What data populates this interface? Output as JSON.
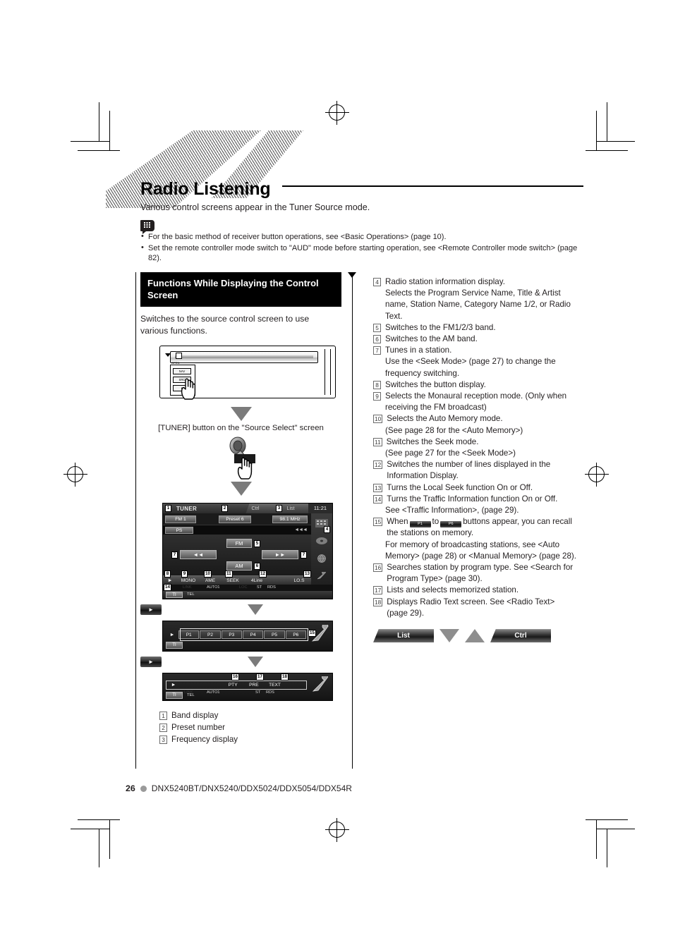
{
  "page": {
    "title": "Radio Listening",
    "intro": "Various control screens appear in the Tuner Source mode.",
    "note_icon": "note-book-icon",
    "notes": [
      "For the basic method of receiver button operations, see <Basic Operations> (page 10).",
      "Set the remote controller mode switch to \"AUD\" mode before starting operation, see <Remote Controller mode switch> (page 82)."
    ],
    "footer": {
      "page_number": "26",
      "models": "DNX5240BT/DNX5240/DDX5024/DDX5054/DDX54R"
    }
  },
  "left_column": {
    "section_heading": "Functions While Displaying the Control Screen",
    "lead": "Switches to the source control screen to use various functions.",
    "device": {
      "button_labels": [
        "NAV",
        "SRC",
        "■"
      ],
      "top_label": "OPEN",
      "hand_icon": "pointing-hand-icon"
    },
    "caption": "[TUNER] button on the \"Source Select\" screen",
    "speaker_icon": "speaker-icon",
    "speaker_hand_icon": "pointing-hand-icon",
    "control_screen": {
      "source_name": "TUNER",
      "ctrl_tab": "Ctrl",
      "list_tab": "List",
      "clock": "11:21",
      "band": "FM   1",
      "preset": "Preset  6",
      "frequency": "98.1 MHz",
      "ps_name": "PS",
      "seek_marker": "◄◄◄",
      "fm_button": "FM",
      "am_button": "AM",
      "prev_button": "◄◄",
      "next_button": "►►",
      "play_button": "►",
      "bottom_buttons": [
        "MONO",
        "AME",
        "SEEK",
        "4Line",
        "",
        "LO.S"
      ],
      "status_row": [
        "AUTO1",
        "ST",
        "RDS"
      ],
      "ti_button": "TI",
      "tel_label": "TEL",
      "callouts": [
        "1",
        "2",
        "3",
        "4",
        "5",
        "6",
        "7",
        "7",
        "8",
        "9",
        "10",
        "11",
        "12",
        "13",
        "14"
      ]
    },
    "preset_panel": {
      "play_button": "►",
      "presets": [
        "P1",
        "P2",
        "P3",
        "P4",
        "P5",
        "P6"
      ],
      "ti_button": "TI",
      "callout": "15"
    },
    "text_panel": {
      "play_button": "►",
      "buttons": [
        "PTY",
        "PRE",
        "TEXT"
      ],
      "status_row": [
        "AUTO1",
        "ST",
        "RDS"
      ],
      "ti_button": "TI",
      "tel_label": "TEL",
      "callouts": [
        "16",
        "17",
        "18"
      ]
    },
    "transition_play_label": "►",
    "legend": [
      {
        "num": "1",
        "text": "Band display"
      },
      {
        "num": "2",
        "text": "Preset number"
      },
      {
        "num": "3",
        "text": "Frequency display"
      }
    ]
  },
  "right_column": {
    "items": [
      {
        "num": "4",
        "text": "Radio station information display.",
        "sub": [
          "Selects the Program Service Name, Title & Artist name, Station Name, Category Name 1/2, or Radio Text."
        ]
      },
      {
        "num": "5",
        "text": "Switches to the FM1/2/3 band.",
        "sub": []
      },
      {
        "num": "6",
        "text": "Switches to the AM band.",
        "sub": []
      },
      {
        "num": "7",
        "text": "Tunes in a station.",
        "sub": [
          "Use the <Seek Mode> (page 27) to change the frequency switching."
        ]
      },
      {
        "num": "8",
        "text": "Switches the button display.",
        "sub": []
      },
      {
        "num": "9",
        "text": "Selects the Monaural reception mode. (Only when receiving the FM broadcast)",
        "sub": []
      },
      {
        "num": "10",
        "text": "Selects the Auto Memory mode.",
        "sub": [
          "(See page 28 for the <Auto Memory>)"
        ]
      },
      {
        "num": "11",
        "text": "Switches the Seek mode.",
        "sub": [
          "(See page 27 for the <Seek Mode>)"
        ]
      },
      {
        "num": "12",
        "text": "Switches the number of lines displayed in the Information Display.",
        "sub": []
      },
      {
        "num": "13",
        "text": "Turns the Local Seek function On or Off.",
        "sub": []
      },
      {
        "num": "14",
        "text": "Turns the Traffic Information function On or Off.",
        "sub": [
          "See <Traffic Information>, (page 29)."
        ]
      },
      {
        "num": "15",
        "text_before": "When",
        "btn1": "P1",
        "text_middle": "to",
        "btn2": "P6",
        "text_after": "buttons appear, you can recall the stations on memory.",
        "sub": [
          "For memory of broadcasting stations, see <Auto Memory> (page 28) or <Manual Memory> (page 28)."
        ]
      },
      {
        "num": "16",
        "text": "Searches station by program type. See <Search for Program Type> (page 30).",
        "sub": []
      },
      {
        "num": "17",
        "text": "Lists and selects memorized station.",
        "sub": []
      },
      {
        "num": "18",
        "text": "Displays Radio Text screen. See <Radio Text> (page 29).",
        "sub": []
      }
    ],
    "tabs": {
      "list_label": "List",
      "ctrl_label": "Ctrl",
      "down_arrow_icon": "triangle-down-icon",
      "up_arrow_icon": "triangle-up-icon"
    }
  },
  "colors": {
    "text": "#231f20",
    "heading_bg": "#000000",
    "arrow_gray": "#7b7b7b",
    "footer_dot": "#9a9a9a"
  }
}
